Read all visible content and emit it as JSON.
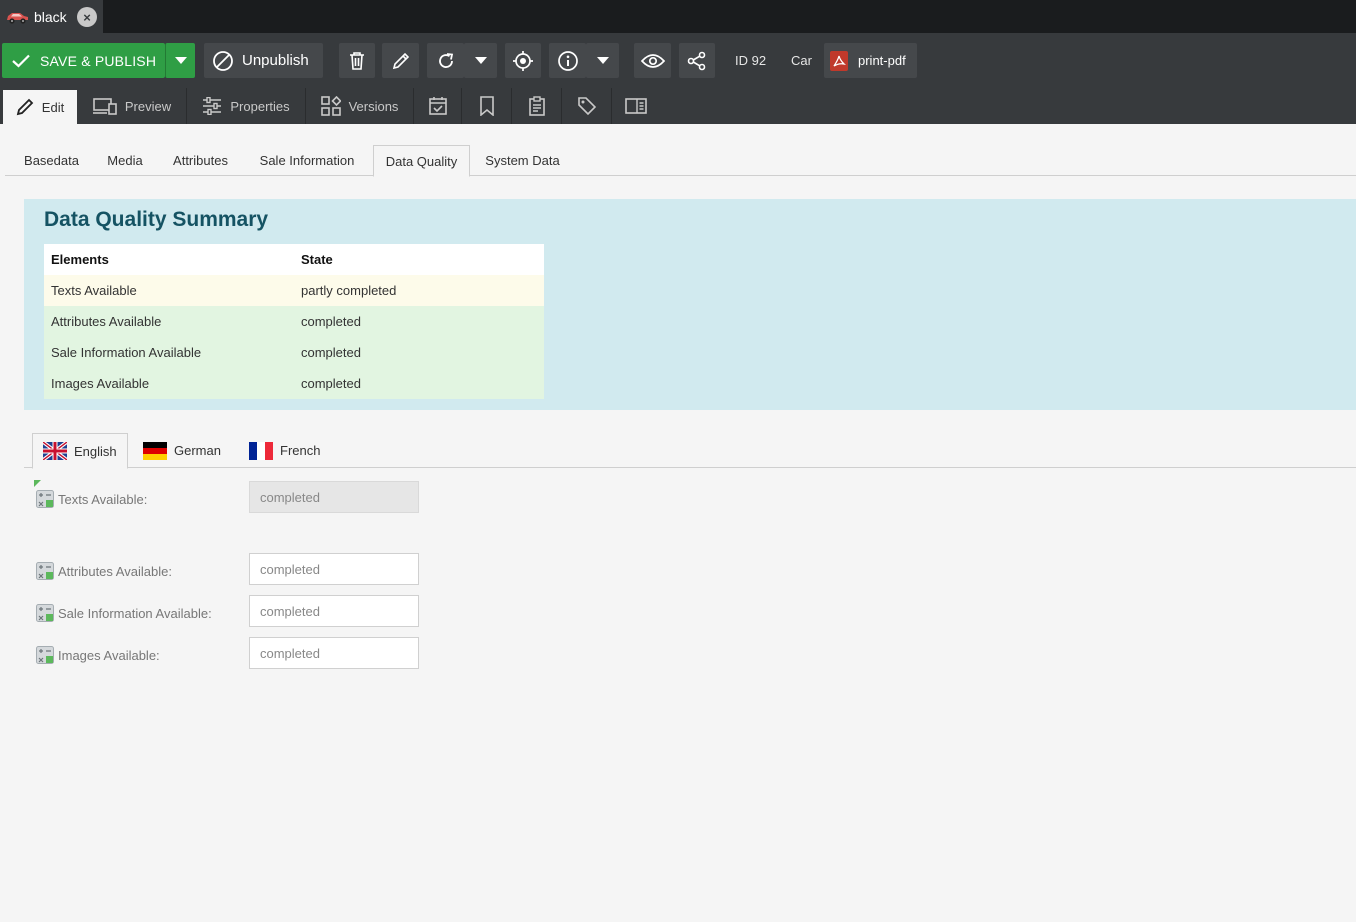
{
  "window_tab": {
    "title": "black",
    "icon": "car-icon"
  },
  "toolbar": {
    "save_publish_label": "SAVE & PUBLISH",
    "unpublish_label": "Unpublish",
    "id_label": "ID 92",
    "class_label": "Car",
    "print_pdf_label": "print-pdf",
    "accent_color": "#2f9e45"
  },
  "edit_tabs": {
    "edit": "Edit",
    "preview": "Preview",
    "properties": "Properties",
    "versions": "Versions"
  },
  "sub_tabs": [
    "Basedata",
    "Media",
    "Attributes",
    "Sale Information",
    "Data Quality",
    "System Data"
  ],
  "summary": {
    "title": "Data Quality Summary",
    "headers": [
      "Elements",
      "State"
    ],
    "rows": [
      {
        "element": "Texts Available",
        "state": "partly completed"
      },
      {
        "element": "Attributes Available",
        "state": "completed"
      },
      {
        "element": "Sale Information Available",
        "state": "completed"
      },
      {
        "element": "Images Available",
        "state": "completed"
      }
    ]
  },
  "languages": [
    "English",
    "German",
    "French"
  ],
  "fields": [
    {
      "label": "Texts Available:",
      "value": "completed"
    },
    {
      "label": "Attributes Available:",
      "value": "completed"
    },
    {
      "label": "Sale Information Available:",
      "value": "completed"
    },
    {
      "label": "Images Available:",
      "value": "completed"
    }
  ]
}
